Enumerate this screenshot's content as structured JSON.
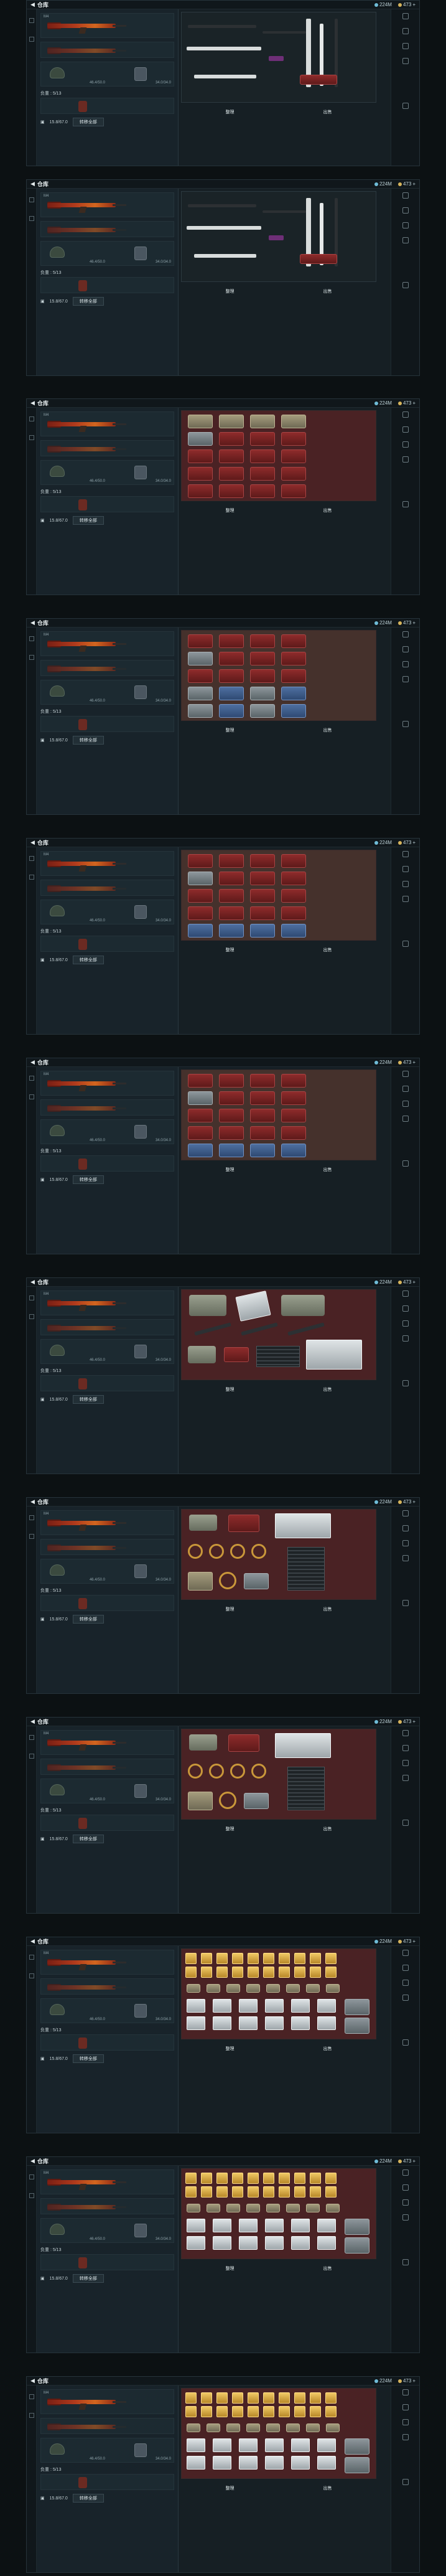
{
  "panels": [
    {
      "title": "仓库",
      "variant": "dark",
      "currency_a": "224M",
      "currency_b": "473",
      "weapon": "M4",
      "weight": "负重 : 5/13",
      "armor_a": "46.4/50.0",
      "armor_b": "34.0/34.0",
      "money": "15.8/67.0",
      "button": "转移全部",
      "foot_left": "整理",
      "foot_right": "出售",
      "partial_top": true
    },
    {
      "title": "仓库",
      "variant": "dark",
      "currency_a": "224M",
      "currency_b": "473",
      "weapon": "M4",
      "weight": "负重 : 5/13",
      "armor_a": "46.4/50.0",
      "armor_b": "34.0/34.0",
      "money": "15.8/67.0",
      "button": "转移全部",
      "foot_left": "整理",
      "foot_right": "出售"
    },
    {
      "title": "仓库",
      "variant": "red",
      "currency_a": "224M",
      "currency_b": "473",
      "weapon": "M4",
      "weight": "负重 : 5/13",
      "armor_a": "46.4/50.0",
      "armor_b": "34.0/34.0",
      "money": "15.8/67.0",
      "button": "转移全部",
      "foot_left": "整理",
      "foot_right": "出售"
    },
    {
      "title": "仓库",
      "variant": "brown",
      "currency_a": "224M",
      "currency_b": "473",
      "weapon": "M4",
      "weight": "负重 : 5/13",
      "armor_a": "46.4/50.0",
      "armor_b": "34.0/34.0",
      "money": "15.8/67.0",
      "button": "转移全部",
      "foot_left": "整理",
      "foot_right": "出售"
    },
    {
      "title": "仓库",
      "variant": "brown",
      "currency_a": "224M",
      "currency_b": "473",
      "weapon": "M4",
      "weight": "负重 : 5/13",
      "armor_a": "46.4/50.0",
      "armor_b": "34.0/34.0",
      "money": "15.8/67.0",
      "button": "转移全部",
      "foot_left": "整理",
      "foot_right": "出售"
    },
    {
      "title": "仓库",
      "variant": "brown",
      "currency_a": "224M",
      "currency_b": "473",
      "weapon": "M4",
      "weight": "负重 : 5/13",
      "armor_a": "46.4/50.0",
      "armor_b": "34.0/34.0",
      "money": "15.8/67.0",
      "button": "转移全部",
      "foot_left": "整理",
      "foot_right": "出售"
    },
    {
      "title": "仓库",
      "variant": "red",
      "currency_a": "224M",
      "currency_b": "473",
      "weapon": "M4",
      "weight": "负重 : 5/13",
      "armor_a": "46.4/50.0",
      "armor_b": "34.0/34.0",
      "money": "15.8/67.0",
      "button": "转移全部",
      "foot_left": "整理",
      "foot_right": "出售"
    },
    {
      "title": "仓库",
      "variant": "red",
      "currency_a": "224M",
      "currency_b": "473",
      "weapon": "M4",
      "weight": "负重 : 5/13",
      "armor_a": "46.4/50.0",
      "armor_b": "34.0/34.0",
      "money": "15.8/67.0",
      "button": "转移全部",
      "foot_left": "整理",
      "foot_right": "出售"
    },
    {
      "title": "仓库",
      "variant": "red",
      "currency_a": "224M",
      "currency_b": "473",
      "weapon": "M4",
      "weight": "负重 : 5/13",
      "armor_a": "46.4/50.0",
      "armor_b": "34.0/34.0",
      "money": "15.8/67.0",
      "button": "转移全部",
      "foot_left": "整理",
      "foot_right": "出售"
    },
    {
      "title": "仓库",
      "variant": "red",
      "currency_a": "224M",
      "currency_b": "473",
      "weapon": "M4",
      "weight": "负重 : 5/13",
      "armor_a": "46.4/50.0",
      "armor_b": "34.0/34.0",
      "money": "15.8/67.0",
      "button": "转移全部",
      "foot_left": "整理",
      "foot_right": "出售"
    },
    {
      "title": "仓库",
      "variant": "red",
      "currency_a": "224M",
      "currency_b": "473",
      "weapon": "M4",
      "weight": "负重 : 5/13",
      "armor_a": "46.4/50.0",
      "armor_b": "34.0/34.0",
      "money": "15.8/67.0",
      "button": "转移全部",
      "foot_left": "整理",
      "foot_right": "出售"
    },
    {
      "title": "仓库",
      "variant": "red",
      "currency_a": "224M",
      "currency_b": "473",
      "weapon": "M4",
      "weight": "负重 : 5/13",
      "armor_a": "46.4/50.0",
      "armor_b": "34.0/34.0",
      "money": "15.8/67.0",
      "button": "转移全部",
      "foot_left": "整理",
      "foot_right": "出售"
    }
  ]
}
